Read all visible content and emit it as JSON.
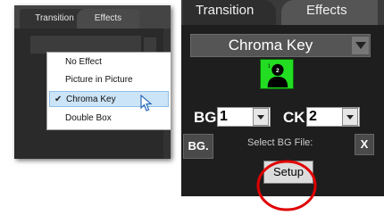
{
  "left_panel": {
    "tabs": [
      "Transition",
      "Effects"
    ],
    "menu": {
      "items": [
        {
          "label": "No Effect",
          "selected": false
        },
        {
          "label": "Picture in Picture",
          "selected": false
        },
        {
          "label": "Chroma Key",
          "selected": true
        },
        {
          "label": "Double Box",
          "selected": false
        }
      ],
      "check_glyph": "✔"
    }
  },
  "right_panel": {
    "tabs": [
      "Transition",
      "Effects"
    ],
    "effect_select": {
      "value": "Chroma Key"
    },
    "bg_label": "BG",
    "bg_value": "1",
    "ck_label": "CK",
    "ck_value": "2",
    "bg_button": "BG.",
    "file_hint": "Select BG File:",
    "clear_button": "X",
    "setup_button": "Setup"
  },
  "colors": {
    "panel_bg": "#1e1e1e",
    "chroma_green": "#22dd22",
    "highlight_red": "#e00000",
    "menu_selected": "#cce4f7"
  },
  "icons": {
    "preview": "person-silhouette-icon",
    "cursor": "mouse-pointer-icon",
    "dropdown": "chevron-down-icon",
    "check": "checkmark-icon"
  }
}
